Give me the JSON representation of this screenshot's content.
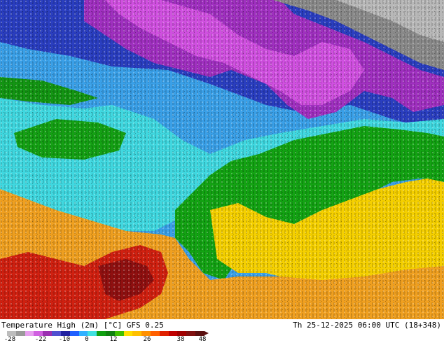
{
  "footer": {
    "title": "Temperature High (2m) [°C] GFS 0.25",
    "datetime": "Th 25-12-2025 06:00 UTC (18+348)"
  },
  "legend": {
    "ticks": [
      "-28",
      "-22",
      "-10",
      "0",
      "12",
      "26",
      "38",
      "48"
    ],
    "colors": [
      "#bdbdbd",
      "#9a9a9a",
      "#e8a0f0",
      "#d060e0",
      "#9a30b0",
      "#5050d0",
      "#2020a0",
      "#2060ff",
      "#30b0ff",
      "#40e0e0",
      "#10a010",
      "#108010",
      "#40c000",
      "#ffe000",
      "#ffc000",
      "#ff9000",
      "#ff6000",
      "#e02000",
      "#c00000",
      "#a00000",
      "#801010",
      "#5a1010"
    ]
  }
}
